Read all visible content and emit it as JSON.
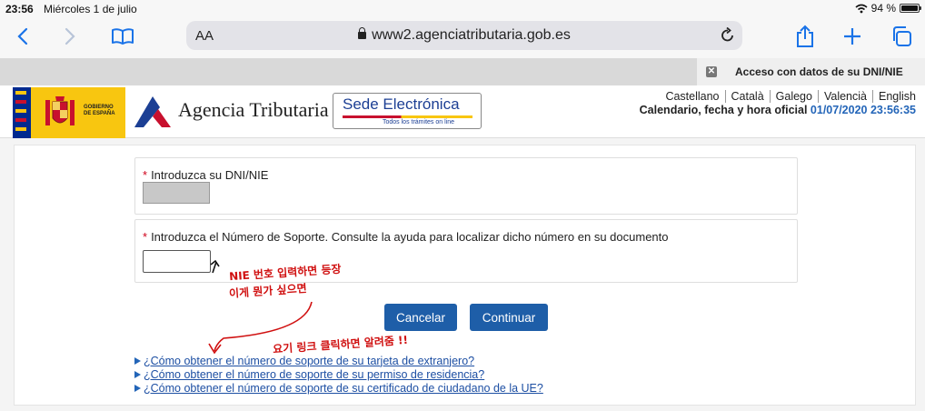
{
  "status_bar": {
    "time": "23:56",
    "date": "Miércoles 1 de julio",
    "battery": "94 %"
  },
  "browser": {
    "text_size_label": "AA",
    "url": "www2.agenciatributaria.gob.es",
    "tab_title": "Acceso con datos de su DNI/NIE",
    "tab_close_glyph": "✕"
  },
  "header": {
    "gobierno_line1": "GOBIERNO",
    "gobierno_line2": "DE ESPAÑA",
    "agency_name": "Agencia Tributaria",
    "sede_title": "Sede Electrónica",
    "sede_subtitle": "Todos los trámites on line",
    "languages": [
      "Castellano",
      "Català",
      "Galego",
      "Valencià",
      "English"
    ],
    "calendar_label": "Calendario, fecha y hora oficial",
    "calendar_datetime": "01/07/2020 23:56:35"
  },
  "form": {
    "required_mark": "*",
    "dni_label": "Introduzca su DNI/NIE",
    "dni_value": "",
    "soporte_label": "Introduzca el Número de Soporte. Consulte la ayuda para localizar dicho número en su documento",
    "soporte_value": "",
    "cancel_label": "Cancelar",
    "continue_label": "Continuar"
  },
  "help_links": [
    "¿Cómo obtener el número de soporte de su tarjeta de extranjero?",
    "¿Cómo obtener el número de soporte de su permiso de residencia?",
    "¿Cómo obtener el número de soporte de su certificado de ciudadano de la UE?"
  ],
  "annotations": {
    "note1_line1": "NIE 번호 입력하면 등장",
    "note1_line2": "이게 뭔가 싶으면",
    "note2": "요기 링크 클릭하면 알려줌 !!"
  },
  "colors": {
    "accent_blue": "#1e5ea8",
    "link_blue": "#1d4fa3",
    "required_red": "#d0021b",
    "annotation_red": "#d01010"
  }
}
